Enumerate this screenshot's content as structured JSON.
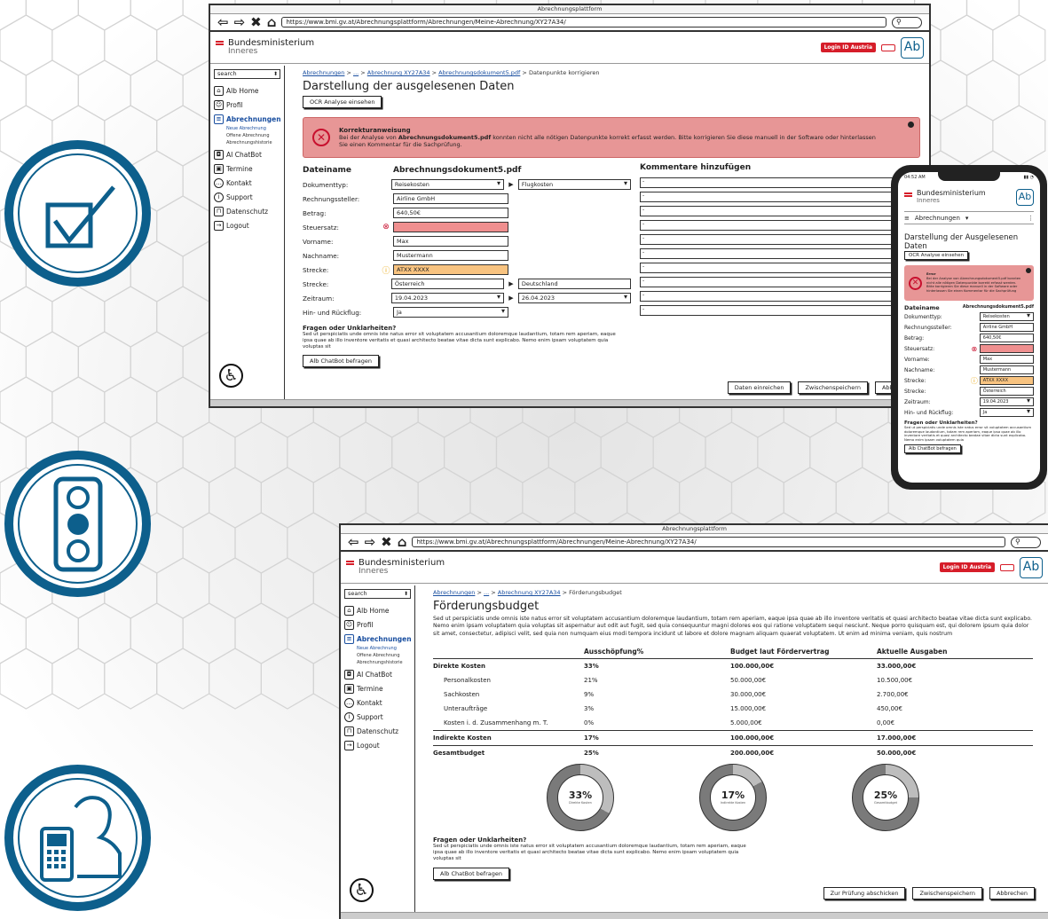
{
  "window_title": "Abrechnungsplattform",
  "ministry": {
    "line1": "Bundesministerium",
    "line2": "Inneres"
  },
  "header": {
    "login_label": "Login ID Austria",
    "ab_label": "Ab"
  },
  "sidebar": {
    "search_placeholder": "search",
    "items": [
      {
        "label": "Alb Home",
        "icon": "home-icon"
      },
      {
        "label": "Profil",
        "icon": "profile-icon"
      },
      {
        "label": "Abrechnungen",
        "icon": "document-icon"
      },
      {
        "label": "AI ChatBot",
        "icon": "robot-icon"
      },
      {
        "label": "Termine",
        "icon": "calendar-icon"
      },
      {
        "label": "Kontakt",
        "icon": "chat-icon"
      },
      {
        "label": "Support",
        "icon": "support-icon"
      },
      {
        "label": "Datenschutz",
        "icon": "lock-icon"
      },
      {
        "label": "Logout",
        "icon": "logout-icon"
      }
    ],
    "sub_items": [
      "Neue Abrechnung",
      "Offene Abrechnung",
      "Abrechnungshistorie"
    ]
  },
  "top": {
    "url": "https://www.bmi.gv.at/Abrechnungsplattform/Abrechnungen/Meine-Abrechnung/XY27A34/",
    "breadcrumb": [
      "Abrechnungen",
      "...",
      "Abrechnung XY27A34",
      "Abrechnungsdokument5.pdf",
      "Datenpunkte korrigieren"
    ],
    "page_title": "Darstellung der ausgelesenen Daten",
    "ocr_button": "OCR Analyse einsehen",
    "alert": {
      "title": "Korrekturanweisung",
      "body_pre": "Bei der Analyse von ",
      "body_doc": "Abrechnungsdokument5.pdf",
      "body_post": " konnten nicht alle nötigen Datenpunkte korrekt erfasst werden. Bitte korrigieren Sie diese manuell in der Software oder hinterlassen",
      "body_line2": "Sie einen Kommentar für die Sachprüfung."
    },
    "form": {
      "file_label": "Dateiname",
      "file_value": "Abrechnungsdokument5.pdf",
      "comments_title": "Kommentare hinzufügen",
      "rows": [
        {
          "label": "Dokumenttyp:",
          "value": "Reisekosten",
          "select": true,
          "second": "Flugkosten",
          "status": ""
        },
        {
          "label": "Rechnungssteller:",
          "value": "Airline GmbH",
          "status": ""
        },
        {
          "label": "Betrag:",
          "value": "640,50€",
          "status": ""
        },
        {
          "label": "Steuersatz:",
          "value": "",
          "status": "error"
        },
        {
          "label": "Vorname:",
          "value": "Max",
          "status": ""
        },
        {
          "label": "Nachname:",
          "value": "Mustermann",
          "status": ""
        },
        {
          "label": "Strecke:",
          "value": "ATXX XXXX",
          "status": "warning"
        },
        {
          "label": "Strecke:",
          "value": "Österreich",
          "second": "Deutschland",
          "status": ""
        },
        {
          "label": "Zeitraum:",
          "value": "19.04.2023",
          "select": true,
          "second": "26.04.2023",
          "status": ""
        },
        {
          "label": "Hin- und Rückflug:",
          "value": "Ja",
          "select": true,
          "status": ""
        }
      ],
      "comment_placeholder": "-"
    },
    "questions_title": "Fragen oder Unklarheiten?",
    "questions_text": "Sed ut perspiciatis unde omnis iste natus error sit voluptatem accusantium doloremque laudantium, totam rem aperiam, eaque ipsa quae ab illo inventore veritatis et quasi architecto beatae vitae dicta sunt explicabo. Nemo enim ipsam voluptatem quia voluptas sit",
    "chatbot_button": "Alb ChatBot befragen",
    "footer_buttons": [
      "Daten einreichen",
      "Zwischenspeichern",
      "Abbrechen"
    ]
  },
  "phone": {
    "time": "04:52 AM",
    "menu_label": "Abrechnungen",
    "page_title": "Darstellung der Ausgelesenen Daten",
    "ocr_button": "OCR Analyse einsehen",
    "alert_title": "Error",
    "alert_text": "Bei der Analyse von Abrechnungsdokument5.pdf konnten nicht alle nötigen Datenpunkte korrekt erfasst werden. Bitte korrigieren Sie diese manuell in der Software oder hinterlassen Sie einen Kommentar für die Sachprüfung",
    "file_label": "Dateiname",
    "file_value": "Abrechnungsdokument5.pdf",
    "rows": [
      {
        "label": "Dokumenttyp:",
        "value": "Reisekosten",
        "status": "",
        "select": true
      },
      {
        "label": "Rechnungssteller:",
        "value": "Airline GmbH",
        "status": ""
      },
      {
        "label": "Betrag:",
        "value": "640,50€",
        "status": ""
      },
      {
        "label": "Steuersatz:",
        "value": "",
        "status": "error"
      },
      {
        "label": "Vorname:",
        "value": "Max",
        "status": ""
      },
      {
        "label": "Nachname:",
        "value": "Mustermann",
        "status": ""
      },
      {
        "label": "Strecke:",
        "value": "ATXX XXXX",
        "status": "warning"
      },
      {
        "label": "Strecke:",
        "value": "Österreich",
        "status": ""
      },
      {
        "label": "Zeitraum:",
        "value": "19.04.2023",
        "status": "",
        "select": true
      },
      {
        "label": "Hin- und Rückflug:",
        "value": "Ja",
        "status": "",
        "select": true
      }
    ],
    "questions_title": "Fragen oder Unklarheiten?",
    "questions_text": "Sed ut perspiciatis unde omnis iste natus error sit voluptatem accusantium doloremque laudantium, totam rem aperiam, eaque ipsa quae ab illo inventore veritatis et quasi architecto beatae vitae dicta sunt explicabo. Nemo enim ipsam voluptatem quia",
    "chatbot_button": "Alb ChatBot befragen"
  },
  "bottom": {
    "url": "https://www.bmi.gv.at/Abrechnungsplattform/Abrechnungen/Meine-Abrechnung/XY27A34/",
    "breadcrumb": [
      "Abrechnungen",
      "...",
      "Abrechnung XY27A34",
      "Förderungsbudget"
    ],
    "page_title": "Förderungsbudget",
    "intro": "Sed ut perspiciatis unde omnis iste natus error sit voluptatem accusantium doloremque laudantium, totam rem aperiam, eaque ipsa quae ab illo inventore veritatis et quasi architecto beatae vitae dicta sunt explicabo. Nemo enim ipsam voluptatem quia voluptas sit aspernatur aut odit aut fugit, sed quia consequuntur magni dolores eos qui ratione voluptatem sequi nesciunt. Neque porro quisquam est, qui dolorem ipsum quia dolor sit amet, consectetur, adipisci velit, sed quia non numquam eius modi tempora incidunt ut labore et dolore magnam aliquam quaerat voluptatem. Ut enim ad minima veniam, quis nostrum",
    "table": {
      "headers": [
        "",
        "Ausschöpfung%",
        "Budget laut Fördervertrag",
        "Aktuelle Ausgaben"
      ],
      "rows": [
        {
          "cells": [
            "Direkte Kosten",
            "33%",
            "100.000,00€",
            "33.000,00€"
          ],
          "style": "bold"
        },
        {
          "cells": [
            "Personalkosten",
            "21%",
            "50.000,00€",
            "10.500,00€"
          ],
          "style": "indent"
        },
        {
          "cells": [
            "Sachkosten",
            "9%",
            "30.000,00€",
            "2.700,00€"
          ],
          "style": "indent"
        },
        {
          "cells": [
            "Unteraufträge",
            "3%",
            "15.000,00€",
            "450,00€"
          ],
          "style": "indent"
        },
        {
          "cells": [
            "Kosten i. d. Zusammenhang m. T.",
            "0%",
            "5.000,00€",
            "0,00€"
          ],
          "style": "indent"
        },
        {
          "cells": [
            "Indirekte Kosten",
            "17%",
            "100.000,00€",
            "17.000,00€"
          ],
          "style": "boldline"
        },
        {
          "cells": [
            "Gesamtbudget",
            "25%",
            "200.000,00€",
            "50.000,00€"
          ],
          "style": "boldline"
        }
      ]
    },
    "donuts": [
      {
        "percent": 33,
        "label": "33%",
        "caption": "Direkte Kosten"
      },
      {
        "percent": 17,
        "label": "17%",
        "caption": "Indirekte Kosten"
      },
      {
        "percent": 25,
        "label": "25%",
        "caption": "Gesamtbudget"
      }
    ],
    "questions_title": "Fragen oder Unklarheiten?",
    "questions_text": "Sed ut perspiciatis unde omnis iste natus error sit voluptatem accusantium doloremque laudantium, totam rem aperiam, eaque ipsa quae ab illo inventore veritatis et quasi architecto beatae vitae dicta sunt explicabo. Nemo enim ipsam voluptatem quia voluptas sit",
    "chatbot_button": "Alb ChatBot befragen",
    "footer_buttons": [
      "Zur Prüfung abschicken",
      "Zwischenspeichern",
      "Abbrechen"
    ]
  },
  "colors": {
    "brand_red": "#d61d29",
    "brand_blue": "#0d5f8c",
    "error_bg": "#ef8f8f",
    "warning_bg": "#f8c380"
  },
  "decor_icons": [
    "checkbox-icon",
    "traffic-light-icon",
    "phone-user-icon"
  ]
}
